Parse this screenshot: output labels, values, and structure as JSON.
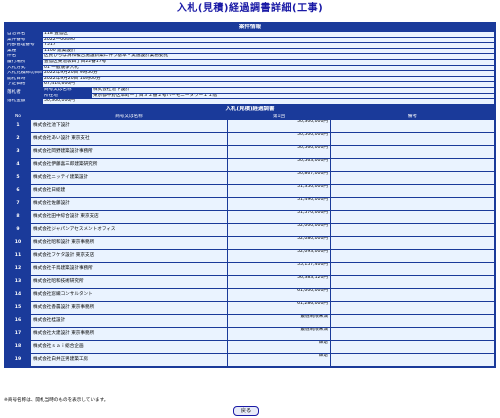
{
  "title": "入札(見積)経過調書詳細(工事)",
  "info": {
    "band": "案件情報",
    "rows": [
      {
        "label": "自治体名",
        "value": "118 豊島区"
      },
      {
        "label": "案件番号",
        "value": "2022一00490"
      },
      {
        "label": "内部管理番号",
        "value": "7517"
      },
      {
        "label": "業種",
        "value": "1100 建築設計"
      },
      {
        "label": "件名",
        "value": "区民ひろば清和複合施設新築に伴う基本・実施設計業務委託"
      },
      {
        "label": "履行場所",
        "value": "豊島区東池袋四丁目22番17号"
      },
      {
        "label": "入札方式",
        "value": "01 一般競争入札"
      },
      {
        "label": "入札見積締切日時",
        "value": "2022年9月20日 9時50分"
      },
      {
        "label": "開札日時",
        "value": "2022年9月20日 10時00分"
      },
      {
        "label": "予定価格",
        "value": "67,414,600円"
      }
    ],
    "winner": {
      "label": "落札者",
      "name_label": "商号又は名称",
      "name_value": "株式会社池下設計",
      "addr_label": "所在地",
      "addr_value": "東京都中野区本町一丁目３２番２号ハーモニータワー１１階"
    },
    "amount": {
      "label": "落札金額",
      "value": "50,300,000円"
    }
  },
  "progress": {
    "band": "入札(見積)経過調書",
    "headers": {
      "no": "No",
      "name": "商号又は名称",
      "round": "第1回",
      "note": "備考"
    },
    "rows": [
      {
        "no": "1",
        "name": "株式会社池下設計",
        "amount": "50,300,000円"
      },
      {
        "no": "2",
        "name": "株式会社あい設計 東京支社",
        "amount": "50,500,000円"
      },
      {
        "no": "3",
        "name": "株式会社岡野建築設計事務所",
        "amount": "50,560,000円"
      },
      {
        "no": "4",
        "name": "株式会社伊藤喜三郎建築研究所",
        "amount": "50,563,000円"
      },
      {
        "no": "5",
        "name": "株式会社ニッテイ建築設計",
        "amount": "50,867,000円"
      },
      {
        "no": "6",
        "name": "株式会社日総建",
        "amount": "51,350,000円"
      },
      {
        "no": "7",
        "name": "株式会社佐藤設計",
        "amount": "51,490,000円"
      },
      {
        "no": "8",
        "name": "株式会社田中綜合設計 東京支店",
        "amount": "51,570,000円"
      },
      {
        "no": "9",
        "name": "株式会社ジャパンアセスメントオフィス",
        "amount": "52,000,000円"
      },
      {
        "no": "10",
        "name": "株式会社昭和設計 東京事務所",
        "amount": "52,080,000円"
      },
      {
        "no": "11",
        "name": "株式会社フケタ設計 東京支店",
        "amount": "52,093,000円"
      },
      {
        "no": "12",
        "name": "株式会社千鳥建築設計事務所",
        "amount": "55,157,400円"
      },
      {
        "no": "13",
        "name": "株式会社昭和技術研究所",
        "amount": "56,383,120円"
      },
      {
        "no": "14",
        "name": "株式会社窓織コンサルタント",
        "amount": "61,000,000円"
      },
      {
        "no": "15",
        "name": "株式会社香農設計 東京事務所",
        "amount": "61,286,000円"
      },
      {
        "no": "16",
        "name": "株式会社桂設計",
        "amount": "最低制限未満"
      },
      {
        "no": "17",
        "name": "株式会社大建設計 東京事務所",
        "amount": "最低制限未満"
      },
      {
        "no": "18",
        "name": "株式会社ｓａｉ総合企画",
        "amount": "辞退"
      },
      {
        "no": "19",
        "name": "株式会社白井正男建築工房",
        "amount": "辞退"
      }
    ]
  },
  "footnote": "※商号名称は、開札当時のものを表示しています。",
  "back_button": "戻る"
}
